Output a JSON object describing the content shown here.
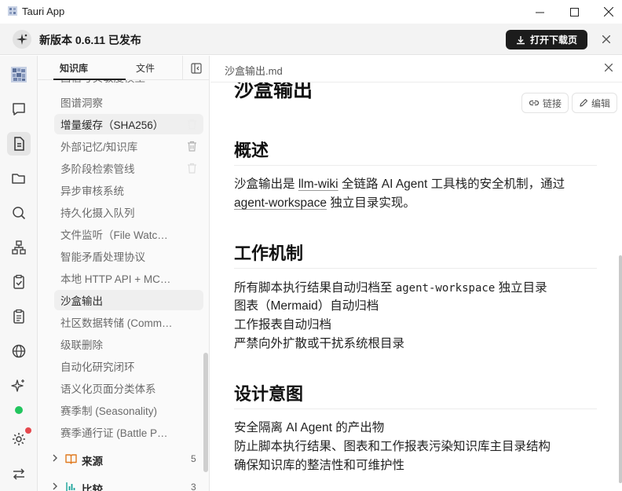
{
  "window": {
    "title": "Tauri App"
  },
  "banner": {
    "text": "新版本 0.6.11 已发布",
    "download_label": "打开下载页"
  },
  "sidebar": {
    "tabs": [
      "知识库",
      "文件"
    ],
    "items": [
      "图谱洞察",
      "增量缓存（SHA256）",
      "外部记忆/知识库",
      "多阶段检索管线",
      "异步审核系统",
      "持久化摄入队列",
      "文件监听（File Watc…",
      "智能矛盾处理协议",
      "本地 HTTP API + MC…",
      "沙盒输出",
      "社区数据转储 (Comm…",
      "级联删除",
      "自动化研究闭环",
      "语义化页面分类体系",
      "赛季制 (Seasonality)",
      "赛季通行证 (Battle P…"
    ],
    "partial_top": "西信号实敏度模型",
    "groups": [
      {
        "label": "来源",
        "count": "5"
      },
      {
        "label": "比较",
        "count": "3"
      }
    ]
  },
  "editor": {
    "tab_title": "沙盒输出.md",
    "actions": {
      "link": "链接",
      "edit": "编辑"
    },
    "title": "沙盒输出",
    "sections": {
      "overview_heading": "概述",
      "overview_p1": "沙盒输出是",
      "overview_link1": "llm-wiki",
      "overview_p2": "全链路 AI Agent 工具栈的安全机制，通过",
      "overview_link2": "agent-workspace",
      "overview_p3": "独立目录实现。",
      "mechanism_heading": "工作机制",
      "mech_1a": "所有脚本执行结果自动归档至",
      "mech_1code": "agent-workspace",
      "mech_1b": "独立目录",
      "mech_2": "图表（Mermaid）自动归档",
      "mech_3": "工作报表自动归档",
      "mech_4": "严禁向外扩散或干扰系统根目录",
      "intent_heading": "设计意图",
      "intent_1": "安全隔离 AI Agent 的产出物",
      "intent_2": "防止脚本执行结果、图表和工作报表污染知识库主目录结构",
      "intent_3": "确保知识库的整洁性和可维护性"
    }
  }
}
